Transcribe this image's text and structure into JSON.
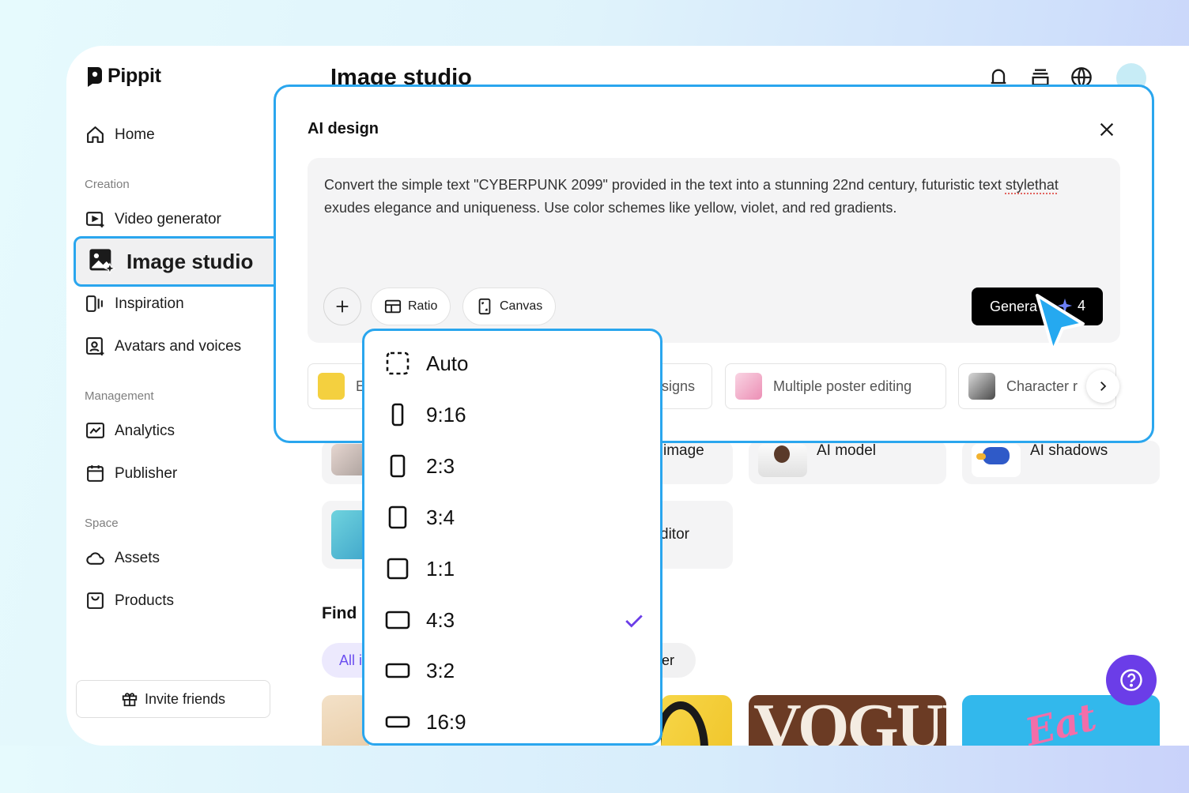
{
  "app": {
    "name": "Pippit"
  },
  "sidebar": {
    "home": "Home",
    "sections": {
      "creation": "Creation",
      "management": "Management",
      "space": "Space"
    },
    "items": [
      {
        "label": "Video generator",
        "icon": "video-generator-icon"
      },
      {
        "label": "Image studio",
        "icon": "image-studio-icon",
        "selected": true
      },
      {
        "label": "Inspiration",
        "icon": "inspiration-icon"
      },
      {
        "label": "Avatars and voices",
        "icon": "avatar-icon"
      },
      {
        "label": "Analytics",
        "icon": "analytics-icon"
      },
      {
        "label": "Publisher",
        "icon": "calendar-icon"
      },
      {
        "label": "Assets",
        "icon": "cloud-icon"
      },
      {
        "label": "Products",
        "icon": "products-icon"
      }
    ],
    "invite": "Invite friends"
  },
  "main": {
    "title": "Image studio",
    "tools": [
      {
        "label": "image"
      },
      {
        "label": "AI model"
      },
      {
        "label": "AI shadows"
      },
      {
        "label": "ditor"
      }
    ],
    "find_title": "Find",
    "chips": [
      "All i",
      "ter"
    ],
    "gallery": [
      "VOGUE",
      "Eat"
    ]
  },
  "modal": {
    "title": "AI design",
    "prompt_before": "Convert the simple text \"CYBERPUNK 2099\" provided in the text into a stunning 22nd century, futuristic text ",
    "prompt_misspelled": "stylethat",
    "prompt_after": " exudes elegance and uniqueness. Use color schemes like yellow, violet, and red gradients.",
    "ratio_label": "Ratio",
    "canvas_label": "Canvas",
    "generate_label": "Genera",
    "generate_cost": "4",
    "suggestions": [
      {
        "label": "E"
      },
      {
        "label": "signs"
      },
      {
        "label": "Multiple poster editing"
      },
      {
        "label": "Character r"
      }
    ]
  },
  "ratio_dropdown": {
    "options": [
      {
        "label": "Auto",
        "icon": "auto-ratio-icon"
      },
      {
        "label": "9:16",
        "icon": "portrait-9-16-icon"
      },
      {
        "label": "2:3",
        "icon": "portrait-2-3-icon"
      },
      {
        "label": "3:4",
        "icon": "portrait-3-4-icon"
      },
      {
        "label": "1:1",
        "icon": "square-1-1-icon"
      },
      {
        "label": "4:3",
        "icon": "landscape-4-3-icon",
        "selected": true
      },
      {
        "label": "3:2",
        "icon": "landscape-3-2-icon"
      },
      {
        "label": "16:9",
        "icon": "landscape-16-9-icon"
      }
    ]
  },
  "colors": {
    "accent": "#6b3de8",
    "highlight": "#2aa6ee",
    "primary_button": "#000000"
  }
}
